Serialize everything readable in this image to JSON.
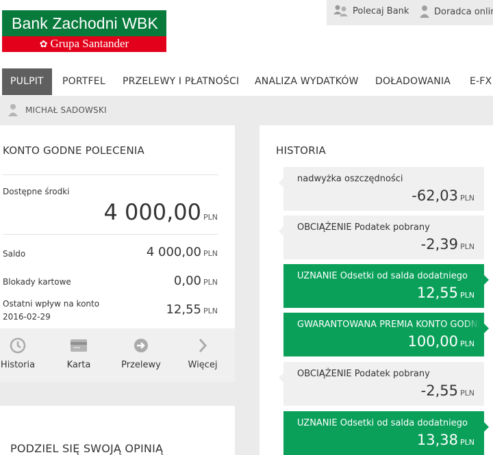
{
  "header": {
    "logo_line1": "Bank Zachodni WBK",
    "logo_line2": "Grupa Santander",
    "links": [
      {
        "label": "Polecaj Bank",
        "icon": "people-icon"
      },
      {
        "label": "Doradca online",
        "icon": "advisor-icon"
      }
    ],
    "brand_green": "#087a3c",
    "brand_red": "#e2001a"
  },
  "nav": {
    "items": [
      "PULPIT",
      "PORTFEL",
      "PRZELEWY I PŁATNOŚCI",
      "ANALIZA WYDATKÓW",
      "DOŁADOWANIA",
      "E-FX"
    ],
    "active": "PULPIT"
  },
  "user": {
    "name": "MICHAŁ SADOWSKI",
    "icon": "user-icon"
  },
  "account": {
    "title": "KONTO GODNE POLECENIA",
    "available_label": "Dostępne środki",
    "available_value": "4 000,00",
    "currency": "PLN",
    "rows": [
      {
        "label": "Saldo",
        "value": "4 000,00",
        "currency": "PLN"
      },
      {
        "label": "Blokady kartowe",
        "value": "0,00",
        "currency": "PLN"
      },
      {
        "label": "Ostatni wpływ na konto",
        "sub": "2016-02-29",
        "value": "12,55",
        "currency": "PLN"
      }
    ],
    "actions": [
      {
        "label": "Historia",
        "icon": "clock-icon"
      },
      {
        "label": "Karta",
        "icon": "card-icon"
      },
      {
        "label": "Przelewy",
        "icon": "arrow-circle-icon"
      },
      {
        "label": "Więcej",
        "icon": "chevron-right-icon"
      }
    ]
  },
  "opinion": {
    "title": "PODZIEL SIĘ SWOJĄ OPINIĄ"
  },
  "history": {
    "title": "HISTORIA",
    "accent_green": "#0aa05a",
    "items": [
      {
        "desc": "nadwyżka oszczędności",
        "amount": "-62,03",
        "currency": "PLN",
        "type": "debit"
      },
      {
        "desc": "OBCIĄŻENIE Podatek pobrany",
        "amount": "-2,39",
        "currency": "PLN",
        "type": "debit"
      },
      {
        "desc": "UZNANIE Odsetki od salda dodatniego",
        "amount": "12,55",
        "currency": "PLN",
        "type": "credit"
      },
      {
        "desc": "GWARANTOWANA PREMIA KONTO GODNE POLECENIA",
        "amount": "100,00",
        "currency": "PLN",
        "type": "credit"
      },
      {
        "desc": "OBCIĄŻENIE Podatek pobrany",
        "amount": "-2,55",
        "currency": "PLN",
        "type": "debit"
      },
      {
        "desc": "UZNANIE Odsetki od salda dodatniego",
        "amount": "13,38",
        "currency": "PLN",
        "type": "credit"
      }
    ]
  }
}
